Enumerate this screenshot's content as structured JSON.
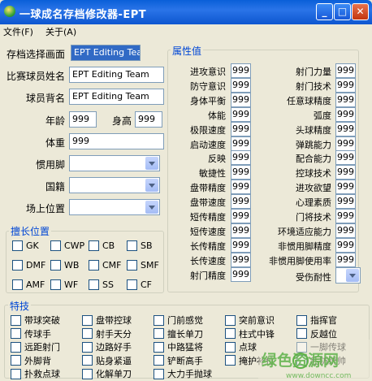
{
  "window": {
    "title": "一球成名存档修改器-EPT",
    "minimize": "_",
    "maximize": "□",
    "close": "✕"
  },
  "menu": {
    "file": "文件(F)",
    "about": "关于(A)"
  },
  "form": {
    "save_select_label": "存档选择画面",
    "save_select_value": "EPT Editing Team",
    "player_name_label": "比赛球员姓名",
    "player_name_value": "EPT Editing Team",
    "back_name_label": "球员背名",
    "back_name_value": "EPT Editing Team",
    "age_label": "年龄",
    "age_value": "999",
    "height_label": "身高",
    "height_value": "999",
    "weight_label": "体重",
    "weight_value": "999",
    "foot_label": "惯用脚",
    "nationality_label": "国籍",
    "position_label": "场上位置"
  },
  "positions": {
    "title": "擅长位置",
    "items": [
      "GK",
      "CWP",
      "CB",
      "SB",
      "DMF",
      "WB",
      "CMF",
      "SMF",
      "AMF",
      "WF",
      "SS",
      "CF"
    ]
  },
  "attributes": {
    "title": "属性值",
    "left": [
      {
        "label": "进攻意识",
        "value": "999"
      },
      {
        "label": "防守意识",
        "value": "999"
      },
      {
        "label": "身体平衡",
        "value": "999"
      },
      {
        "label": "体能",
        "value": "999"
      },
      {
        "label": "极限速度",
        "value": "999"
      },
      {
        "label": "启动速度",
        "value": "999"
      },
      {
        "label": "反映",
        "value": "999"
      },
      {
        "label": "敏捷性",
        "value": "999"
      },
      {
        "label": "盘带精度",
        "value": "999"
      },
      {
        "label": "盘带速度",
        "value": "999"
      },
      {
        "label": "短传精度",
        "value": "999"
      },
      {
        "label": "短传速度",
        "value": "999"
      },
      {
        "label": "长传精度",
        "value": "999"
      },
      {
        "label": "长传速度",
        "value": "999"
      },
      {
        "label": "射门精度",
        "value": "999"
      }
    ],
    "right": [
      {
        "label": "射门力量",
        "value": "999"
      },
      {
        "label": "射门技术",
        "value": "999"
      },
      {
        "label": "任意球精度",
        "value": "999"
      },
      {
        "label": "弧度",
        "value": "999"
      },
      {
        "label": "头球精度",
        "value": "999"
      },
      {
        "label": "弹跳能力",
        "value": "999"
      },
      {
        "label": "配合能力",
        "value": "999"
      },
      {
        "label": "控球技术",
        "value": "999"
      },
      {
        "label": "进攻欲望",
        "value": "999"
      },
      {
        "label": "心理素质",
        "value": "999"
      },
      {
        "label": "门将技术",
        "value": "999"
      },
      {
        "label": "环境适应能力",
        "value": "999"
      },
      {
        "label": "非惯用脚精度",
        "value": "999"
      },
      {
        "label": "非惯用脚使用率",
        "value": "999"
      }
    ],
    "injury_label": "受伤耐性"
  },
  "specials": {
    "title": "特技",
    "items": [
      "带球突破",
      "盘带控球",
      "门前感觉",
      "突前意识",
      "指挥官",
      "传球手",
      "射手天分",
      "擅长单刀",
      "柱式中锋",
      "反越位",
      "远距射门",
      "边路好手",
      "中路猛将",
      "点球",
      "一脚传球",
      "外脚背",
      "贴身紧逼",
      "铲断高手",
      "掩护补位",
      "后防统帅",
      "扑救点球",
      "化解单刀",
      "大力手抛球"
    ]
  },
  "watermark": {
    "brand": "绿色资源网",
    "url": "www.downcc.com"
  },
  "colors": {
    "title_bar": "#0a5fd8",
    "group_title": "#0046d5",
    "selection": "#316ac5",
    "watermark": "#5fb24a"
  }
}
